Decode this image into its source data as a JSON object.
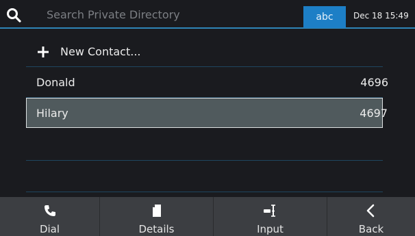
{
  "header": {
    "search_placeholder": "Search Private Directory",
    "input_mode": "abc",
    "datetime": "Dec 18 15:49",
    "accent_color": "#1d7fc6"
  },
  "contacts": {
    "new_contact_label": "New Contact...",
    "rows": [
      {
        "name": "Donald",
        "number": "4696",
        "selected": false
      },
      {
        "name": "Hilary",
        "number": "4697",
        "selected": true
      }
    ]
  },
  "softkeys": [
    {
      "label": "Dial",
      "icon": "phone-icon"
    },
    {
      "label": "Details",
      "icon": "document-icon"
    },
    {
      "label": "Input",
      "icon": "text-cursor-icon"
    },
    {
      "label": "Back",
      "icon": "chevron-left-icon"
    }
  ]
}
